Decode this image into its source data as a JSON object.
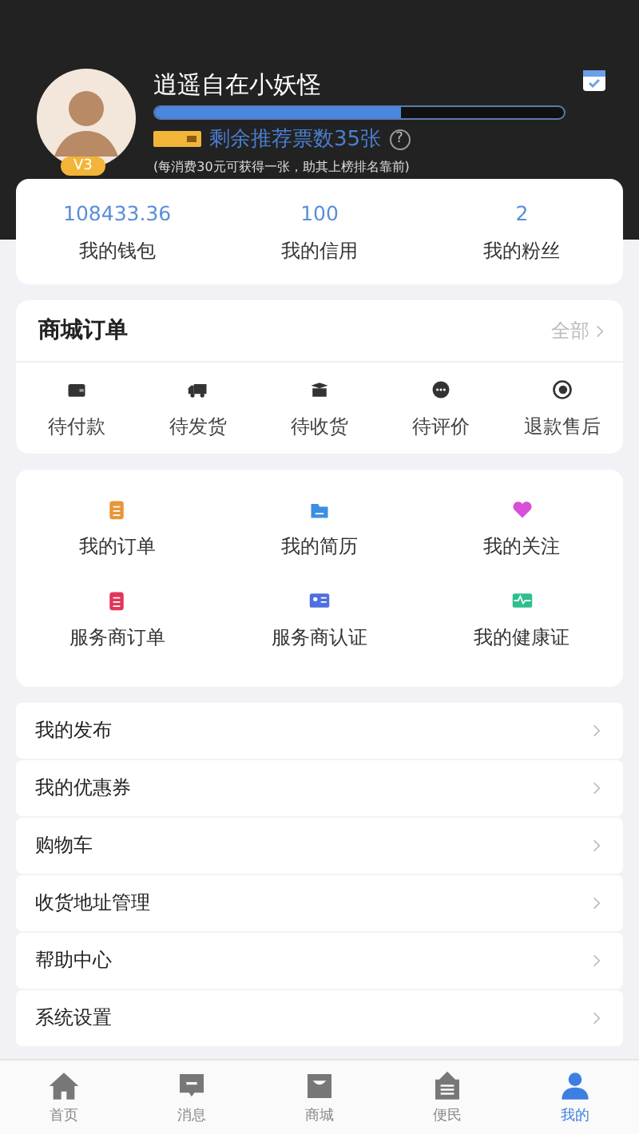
{
  "profile": {
    "name": "逍遥自在小妖怪",
    "vip_level": "V3",
    "level": 0.6,
    "tickets": "剩余推荐票数35张",
    "help": "?",
    "note": "(每消费30元可获得一张，助其上榜排名靠前)"
  },
  "stats": [
    {
      "value": "108433.36",
      "label": "我的钱包"
    },
    {
      "value": "100",
      "label": "我的信用"
    },
    {
      "value": "2",
      "label": "我的粉丝"
    }
  ],
  "orders": {
    "title": "商城订单",
    "all": "全部",
    "items": [
      {
        "kind": "wallet",
        "label": "待付款"
      },
      {
        "kind": "truck",
        "label": "待发货"
      },
      {
        "kind": "box",
        "label": "待收货"
      },
      {
        "kind": "chat",
        "label": "待评价"
      },
      {
        "kind": "refund",
        "label": "退款售后"
      }
    ]
  },
  "services": [
    {
      "kind": "clipboard",
      "color": "#e8963a",
      "label": "我的订单"
    },
    {
      "kind": "folder",
      "color": "#3d8fe0",
      "label": "我的简历"
    },
    {
      "kind": "heart",
      "color": "#d84fd8",
      "label": "我的关注"
    },
    {
      "kind": "clipboard",
      "color": "#e0365a",
      "label": "服务商订单"
    },
    {
      "kind": "card",
      "color": "#4f6fe0",
      "label": "服务商认证"
    },
    {
      "kind": "pulse",
      "color": "#2fbf8f",
      "label": "我的健康证"
    }
  ],
  "menu": [
    "我的发布",
    "我的优惠券",
    "购物车",
    "收货地址管理",
    "帮助中心",
    "系统设置"
  ],
  "tabbar": [
    {
      "kind": "home",
      "label": "首页",
      "selected": false
    },
    {
      "kind": "message",
      "label": "消息",
      "selected": false
    },
    {
      "kind": "bag",
      "label": "商城",
      "selected": false
    },
    {
      "kind": "board",
      "label": "便民",
      "selected": false
    },
    {
      "kind": "person",
      "label": "我的",
      "selected": true
    }
  ]
}
